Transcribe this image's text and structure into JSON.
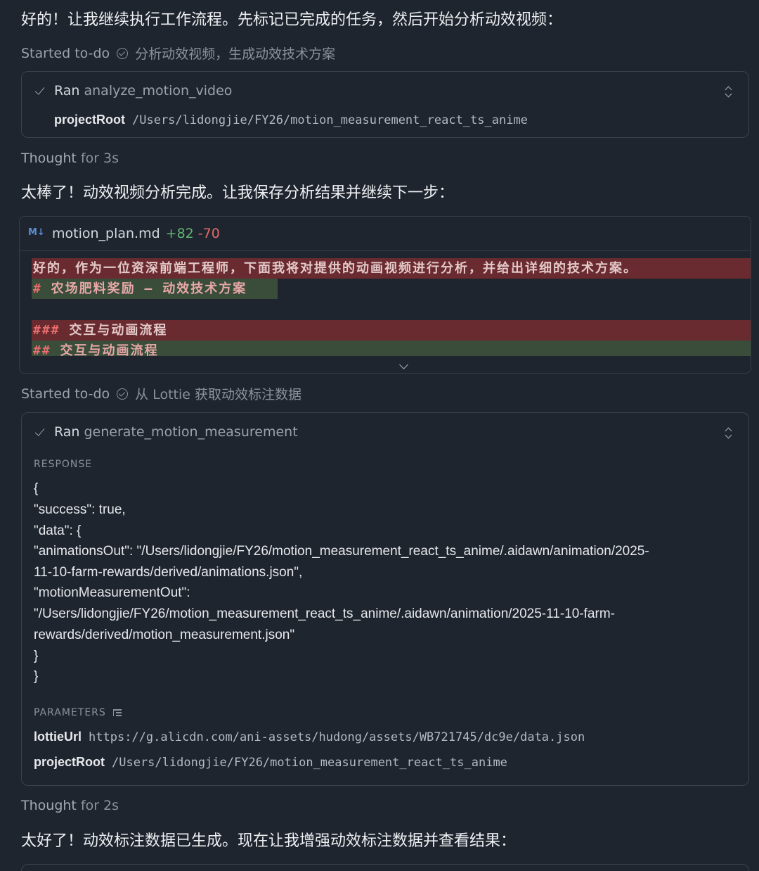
{
  "messages": {
    "intro": "好的！让我继续执行工作流程。先标记已完成的任务，然后开始分析动效视频：",
    "after_analysis": "太棒了！动效视频分析完成。让我保存分析结果并继续下一步：",
    "after_generation": "太好了！动效标注数据已生成。现在让我增强动效标注数据并查看结果："
  },
  "todo1": {
    "label": "Started to-do",
    "task": "分析动效视频，生成动效技术方案"
  },
  "todo2": {
    "label": "Started to-do",
    "task": "从 Lottie 获取动效标注数据"
  },
  "tool1": {
    "ran": "Ran",
    "name": "analyze_motion_video",
    "param_key": "projectRoot",
    "param_value": "/Users/lidongjie/FY26/motion_measurement_react_ts_anime"
  },
  "thought1": {
    "label": "Thought",
    "duration": "for 3s"
  },
  "thought2": {
    "label": "Thought",
    "duration": "for 2s"
  },
  "diff": {
    "icon": "M↓",
    "filename": "motion_plan.md",
    "added": "+82",
    "removed": "-70",
    "lines": [
      {
        "type": "removed",
        "prefix": "",
        "text": "好的，作为一位资深前端工程师，下面我将对提供的动画视频进行分析，并给出详细的技术方案。"
      },
      {
        "type": "added",
        "prefix": "#",
        "text": " 农场肥料奖励 – 动效技术方案"
      },
      {
        "type": "removed",
        "prefix": "###",
        "text": " 交互与动画流程"
      },
      {
        "type": "added",
        "prefix": "##",
        "text": " 交互与动画流程"
      }
    ]
  },
  "tool2": {
    "ran": "Ran",
    "name": "generate_motion_measurement",
    "response_label": "RESPONSE",
    "response_lines": [
      "{",
      "\"success\": true,",
      "\"data\": {",
      "\"animationsOut\": \"/Users/lidongjie/FY26/motion_measurement_react_ts_anime/.aidawn/animation/2025-",
      "11-10-farm-rewards/derived/animations.json\",",
      "\"motionMeasurementOut\":",
      "\"/Users/lidongjie/FY26/motion_measurement_react_ts_anime/.aidawn/animation/2025-11-10-farm-",
      "rewards/derived/motion_measurement.json\"",
      "}",
      "}"
    ],
    "parameters_label": "PARAMETERS",
    "params": [
      {
        "key": "lottieUrl",
        "value": "https://g.alicdn.com/ani-assets/hudong/assets/WB721745/dc9e/data.json"
      },
      {
        "key": "projectRoot",
        "value": "/Users/lidongjie/FY26/motion_measurement_react_ts_anime"
      }
    ]
  }
}
